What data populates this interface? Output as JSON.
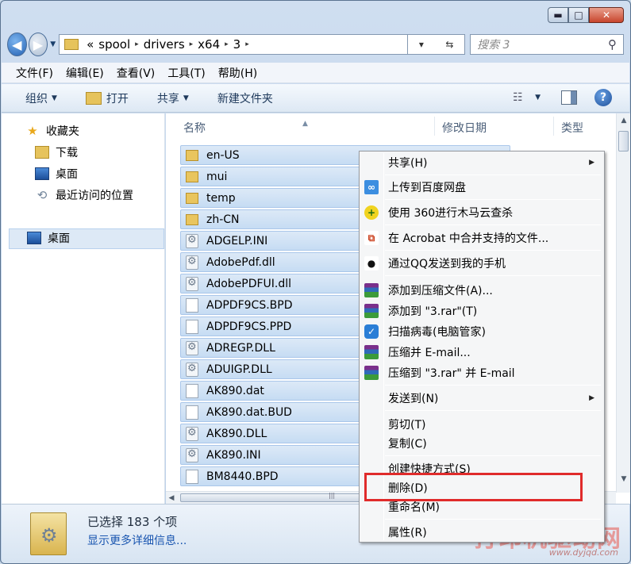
{
  "window": {
    "caption": {
      "min": "▬",
      "max": "□",
      "close": "✕"
    }
  },
  "nav": {
    "back_glyph": "◀",
    "forward_glyph": "▶",
    "history_glyph": "▼",
    "overflow": "«",
    "crumbs": [
      "spool",
      "drivers",
      "x64",
      "3"
    ],
    "crumb_sep": "▸",
    "addr_drop": "▾",
    "refresh_glyph": "⇆",
    "search_placeholder": "搜索 3",
    "search_glyph": "⚲"
  },
  "menubar": [
    "文件(F)",
    "编辑(E)",
    "查看(V)",
    "工具(T)",
    "帮助(H)"
  ],
  "cmdbar": {
    "organize": "组织",
    "open": "打开",
    "share": "共享",
    "new_folder": "新建文件夹",
    "drop": "▼",
    "view_glyph": "☷",
    "help_glyph": "?"
  },
  "navpane": {
    "favorites": "收藏夹",
    "downloads": "下载",
    "desktop_fav": "桌面",
    "recent": "最近访问的位置",
    "desktop": "桌面",
    "star_glyph": "★",
    "recent_glyph": "⟲"
  },
  "columns": {
    "name": "名称",
    "date": "修改日期",
    "type": "类型",
    "sort_glyph": "▲"
  },
  "files": [
    {
      "name": "en-US",
      "icon": "folder-icon"
    },
    {
      "name": "mui",
      "icon": "folder-icon"
    },
    {
      "name": "temp",
      "icon": "folder-icon"
    },
    {
      "name": "zh-CN",
      "icon": "folder-icon"
    },
    {
      "name": "ADGELP.INI",
      "icon": "settings-file-icon"
    },
    {
      "name": "AdobePdf.dll",
      "icon": "settings-file-icon"
    },
    {
      "name": "AdobePDFUI.dll",
      "icon": "settings-file-icon"
    },
    {
      "name": "ADPDF9CS.BPD",
      "icon": "file-icon"
    },
    {
      "name": "ADPDF9CS.PPD",
      "icon": "file-icon"
    },
    {
      "name": "ADREGP.DLL",
      "icon": "settings-file-icon"
    },
    {
      "name": "ADUIGP.DLL",
      "icon": "settings-file-icon"
    },
    {
      "name": "AK890.dat",
      "icon": "file-icon"
    },
    {
      "name": "AK890.dat.BUD",
      "icon": "file-icon"
    },
    {
      "name": "AK890.DLL",
      "icon": "settings-file-icon"
    },
    {
      "name": "AK890.INI",
      "icon": "settings-file-icon"
    },
    {
      "name": "BM8440.BPD",
      "icon": "file-icon"
    }
  ],
  "scroll": {
    "up": "▲",
    "down": "▼",
    "left": "◀",
    "right": "▶",
    "grip": "|||"
  },
  "status": {
    "selected": "已选择 183 个项",
    "details_link": "显示更多详细信息..."
  },
  "watermark": {
    "title": "打印机驱动网",
    "url": "www.dyjqd.com"
  },
  "context_menu": {
    "share": "共享(H)",
    "baidu": "上传到百度网盘",
    "scan360": "使用 360进行木马云查杀",
    "acrobat": "在 Acrobat 中合并支持的文件...",
    "qq": "通过QQ发送到我的手机",
    "add_archive": "添加到压缩文件(A)...",
    "add_rar": "添加到 \"3.rar\"(T)",
    "guard_scan": "扫描病毒(电脑管家)",
    "compress_email": "压缩并 E-mail...",
    "compress_rar_email": "压缩到 \"3.rar\" 并 E-mail",
    "send_to": "发送到(N)",
    "cut": "剪切(T)",
    "copy": "复制(C)",
    "shortcut": "创建快捷方式(S)",
    "delete": "删除(D)",
    "rename": "重命名(M)",
    "properties": "属性(R)",
    "submenu_glyph": "▶"
  },
  "accent": {
    "highlight_border": "#e02b2b",
    "selection": "#c6dcf3"
  }
}
